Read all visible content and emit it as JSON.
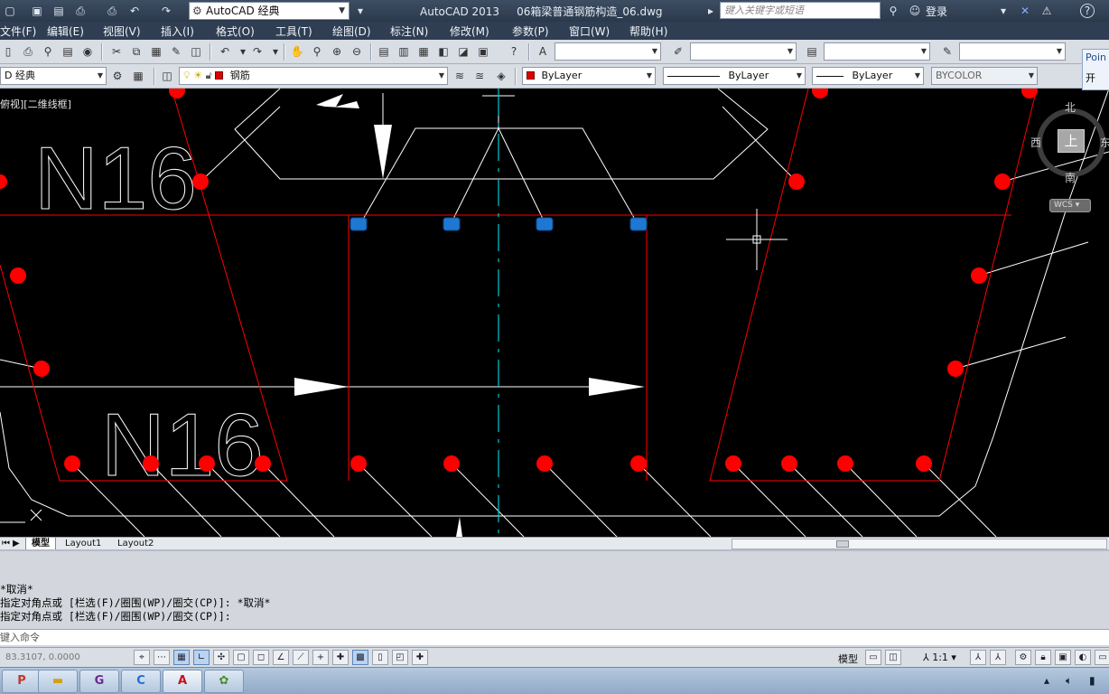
{
  "titlebar": {
    "workspace": "AutoCAD 经典",
    "app_name": "AutoCAD 2013",
    "file_name": "06箱梁普通钢筋构造_06.dwg",
    "search_placeholder": "键入关键字或短语",
    "login": "登录",
    "help": "?"
  },
  "menu": [
    "文件(F)",
    "编辑(E)",
    "视图(V)",
    "插入(I)",
    "格式(O)",
    "工具(T)",
    "绘图(D)",
    "标注(N)",
    "修改(M)",
    "参数(P)",
    "窗口(W)",
    "帮助(H)"
  ],
  "toolbar2": {
    "workspace_combo": "D 经典",
    "layer": "钢筋",
    "color": "ByLayer",
    "linetype": "ByLayer",
    "lineweight": "ByLayer",
    "plotstyle": "BYCOLOR"
  },
  "properties_tip": {
    "line1": "Poin",
    "line2": "开"
  },
  "viewport": {
    "label": "俯视][二维线框]",
    "viewcube": {
      "top_face": "上",
      "north": "北",
      "south": "南",
      "west": "西",
      "east": "东",
      "wcs": "WCS"
    }
  },
  "drawing": {
    "text1": "N16",
    "text2": "N16"
  },
  "tabs": [
    "模型",
    "Layout1",
    "Layout2"
  ],
  "command": {
    "history": [
      "*取消*",
      "指定对角点或 [栏选(F)/圈围(WP)/圈交(CP)]: *取消*",
      "指定对角点或 [栏选(F)/圈围(WP)/圈交(CP)]:"
    ],
    "prompt": "键入命令"
  },
  "status": {
    "coords": "83.3107, 0.0000",
    "model": "模型",
    "scale": "1:1"
  },
  "colors": {
    "rebar": "#ff0000",
    "selected": "#1e78d2",
    "line": "#ffffff",
    "centerline": "#00c8d2",
    "background": "#000000"
  },
  "icons": [
    "save-icon",
    "open-icon",
    "print-icon",
    "undo-icon",
    "redo-icon",
    "pan-icon",
    "zoom-icon",
    "layer-icon",
    "gear-icon",
    "bulb-icon",
    "sun-icon",
    "lock-icon"
  ]
}
